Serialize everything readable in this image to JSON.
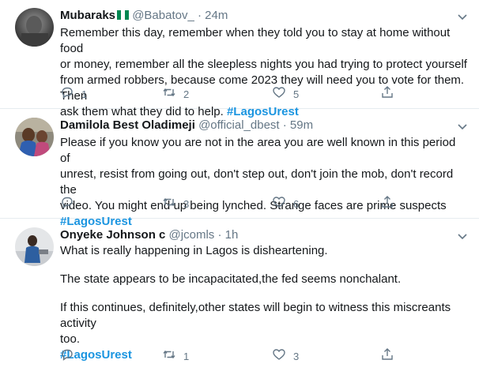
{
  "tweets": [
    {
      "name": "Mubaraks",
      "has_flag": true,
      "handle": "@Babatov_",
      "separator": "·",
      "time": "24m",
      "lines": [
        "Remember this day, remember when they told you to stay at home without food",
        "or money, remember all the sleepless nights you had trying to protect yourself",
        "from armed robbers, because come 2023 they will need you to vote for them. Then",
        "ask them what they did to help."
      ],
      "hashtag": "#LagosUrest",
      "reply_count": "1",
      "retweet_count": "2",
      "like_count": "5"
    },
    {
      "name": "Damilola Best Oladimeji",
      "handle": "@official_dbest",
      "separator": "·",
      "time": "59m",
      "lines": [
        "Please if you know you are not in the area you are well known in this period of",
        "unrest, resist from going out, don't step out, don't join the mob, don't record the",
        "video. You might end up being lynched. Strange faces are prime suspects"
      ],
      "hashtag": "#LagosUrest",
      "reply_count": "",
      "retweet_count": "3",
      "like_count": "6"
    },
    {
      "name": "Onyeke Johnson c",
      "handle": "@jcomls",
      "separator": "·",
      "time": "1h",
      "para1": "What is really happening in Lagos is disheartening.",
      "para2": "The state appears to be incapacitated,the fed seems nonchalant.",
      "para3_line1": "If this continues, definitely,other states will begin to witness this miscreants activity",
      "para3_line2": "too.",
      "hashtag": "#LagosUrest",
      "reply_count": "",
      "retweet_count": "1",
      "like_count": "3"
    }
  ],
  "colors": {
    "text": "#14171a",
    "secondary": "#657786",
    "hashtag": "#1b95e0",
    "divider": "#e6ecf0",
    "flag_green": "#008751"
  },
  "icons": [
    "reply-icon",
    "retweet-icon",
    "like-icon",
    "share-icon",
    "chevron-down-icon"
  ]
}
